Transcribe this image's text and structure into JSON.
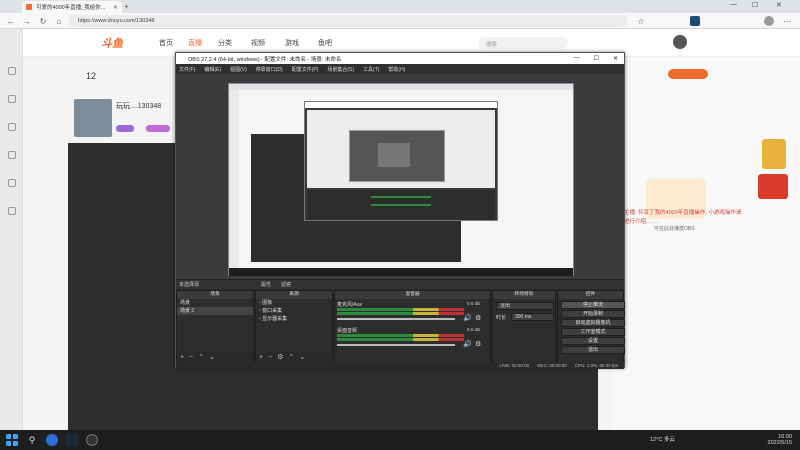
{
  "browser": {
    "tab_title": "可爱的4000年直播_我给你...",
    "new_tab": "+",
    "url": "https://www.douyu.com/130348"
  },
  "douyu": {
    "logo": "斗鱼",
    "nav": [
      "首页",
      "直播",
      "分类",
      "视频",
      "游戏",
      "鱼吧"
    ],
    "follow_count": "12",
    "streamer_name": "玩玩....130348",
    "search_placeholder": "搜索",
    "right_text": "可在此处播放OBS",
    "article": "主播:  共享了我的4000年直播操作,  小游戏操作请进行介绍,  ……"
  },
  "obs": {
    "title": "OBS 27.2.4 (64-bit, windows) - 配置文件: 未命名 - 场景: 未命名",
    "menu": [
      "文件(F)",
      "编辑(E)",
      "视图(V)",
      "停靠窗口(D)",
      "配置文件(P)",
      "场景集合(S)",
      "工具(T)",
      "帮助(H)"
    ],
    "bar": [
      "未选择源",
      "属性",
      "滤镜"
    ],
    "docks": {
      "scenes": {
        "title": "场景",
        "items": [
          "场景",
          "场景 2"
        ]
      },
      "sources": {
        "title": "来源",
        "items": [
          "图像",
          "窗口采集",
          "显示器采集"
        ]
      },
      "mixer": {
        "title": "混音器",
        "channels": [
          {
            "name": "麦克风/Aux",
            "db": "0.0 dB"
          },
          {
            "name": "桌面音频",
            "db": "0.0 dB"
          }
        ]
      },
      "transitions": {
        "title": "转场特效",
        "type": "淡出",
        "duration_label": "时长",
        "duration": "300 ms"
      },
      "controls": {
        "title": "控件",
        "buttons": [
          "停止推流",
          "开始录制",
          "启动虚拟摄像机",
          "工作室模式",
          "设置",
          "退出"
        ]
      }
    },
    "status": {
      "live": "LIVE: 00:00:00",
      "rec": "REC: 00:00:00",
      "cpu": "CPU: 1.0%, 60.00 fps"
    }
  },
  "taskbar": {
    "weather": "12°C 多云",
    "time": "16:00",
    "date": "2022/5/15"
  }
}
